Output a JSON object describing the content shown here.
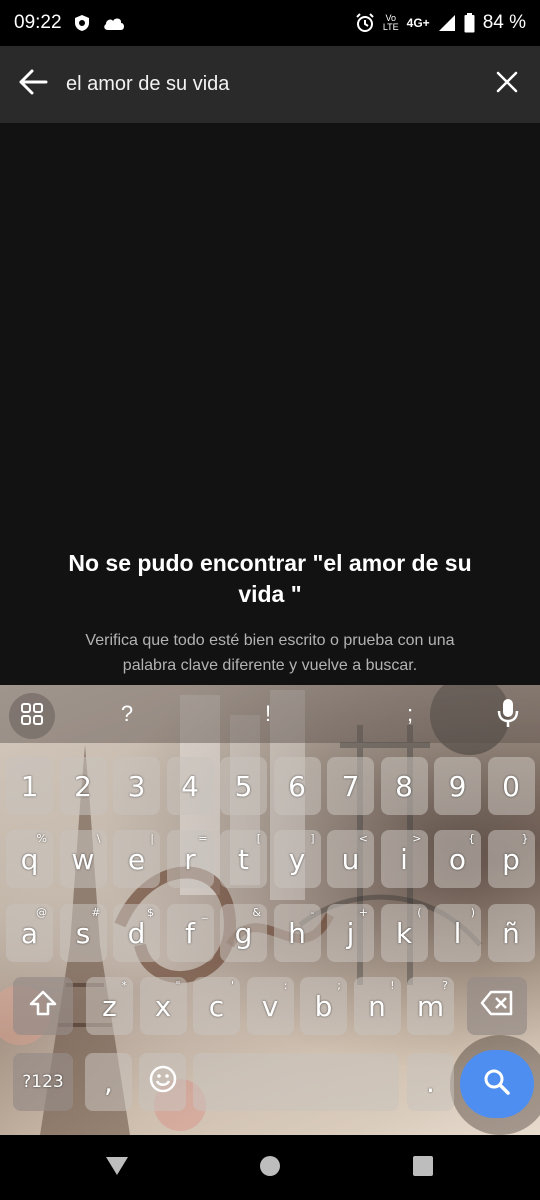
{
  "status_bar": {
    "time": "09:22",
    "battery": "84 %",
    "network": "4G+",
    "volte_top": "Vo",
    "volte_bottom": "LTE"
  },
  "search": {
    "query": "el amor de su vida"
  },
  "empty_state": {
    "title": "No se pudo encontrar \"el amor de su vida \"",
    "subtitle": "Verifica que todo esté bien escrito o prueba con una palabra clave diferente y vuelve a buscar."
  },
  "keyboard": {
    "suggestions": [
      "?",
      "!",
      ";"
    ],
    "number_row": [
      "1",
      "2",
      "3",
      "4",
      "5",
      "6",
      "7",
      "8",
      "9",
      "0"
    ],
    "row1": {
      "keys": [
        "q",
        "w",
        "e",
        "r",
        "t",
        "y",
        "u",
        "i",
        "o",
        "p"
      ],
      "hints": [
        "%",
        "\\",
        "|",
        "=",
        "[",
        "]",
        "<",
        ">",
        "{",
        "}"
      ]
    },
    "row2": {
      "keys": [
        "a",
        "s",
        "d",
        "f",
        "g",
        "h",
        "j",
        "k",
        "l",
        "ñ"
      ],
      "hints": [
        "@",
        "#",
        "$",
        "_",
        "&",
        "-",
        "+",
        "(",
        ")",
        ""
      ]
    },
    "row3": {
      "keys": [
        "z",
        "x",
        "c",
        "v",
        "b",
        "n",
        "m"
      ],
      "hints": [
        "*",
        "\"",
        "'",
        ":",
        ";",
        "!",
        "?"
      ]
    },
    "symbols_key": "?123",
    "comma_key": ",",
    "period_key": "."
  },
  "colors": {
    "accent": "#4e8ef0",
    "background": "#121212",
    "header": "#2a2a2a"
  },
  "icons": {
    "back": "arrow-left-icon",
    "clear": "close-icon",
    "search": "search-icon",
    "mic": "microphone-icon",
    "shift": "shift-icon",
    "backspace": "backspace-icon",
    "emoji": "emoji-icon",
    "apps": "grid-icon"
  }
}
